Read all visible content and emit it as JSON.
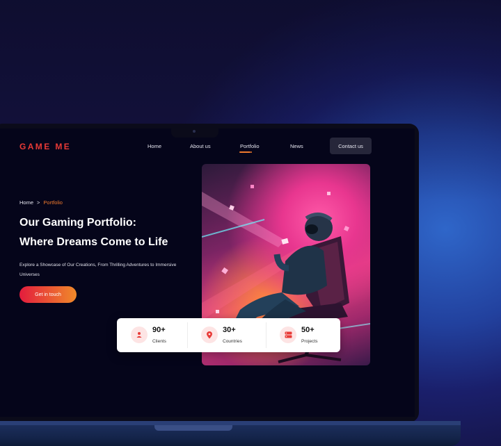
{
  "brand": {
    "logo_text": "GAME ME",
    "accent": "#e83a36",
    "accent_orange": "#f07a2d"
  },
  "nav": {
    "items": [
      {
        "label": "Home"
      },
      {
        "label": "About us"
      },
      {
        "label": "Portfolio",
        "active": true
      },
      {
        "label": "News"
      }
    ],
    "contact_label": "Contact us"
  },
  "breadcrumb": {
    "home": "Home",
    "separator": ">",
    "current": "Portfolio"
  },
  "hero": {
    "title_line1": "Our Gaming Portfolio:",
    "title_line2": "Where Dreams Come to Life",
    "description": "Explore a Showcase of Our Creations, From Thrilling Adventures to Immersive Universes",
    "cta_label": "Get in touch",
    "image_icon": "gamer-in-chair-illustration"
  },
  "stats": [
    {
      "value": "90+",
      "label": "Clients",
      "icon": "user-icon"
    },
    {
      "value": "30+",
      "label": "Countries",
      "icon": "location-pin-icon"
    },
    {
      "value": "50+",
      "label": "Projects",
      "icon": "server-icon"
    }
  ]
}
